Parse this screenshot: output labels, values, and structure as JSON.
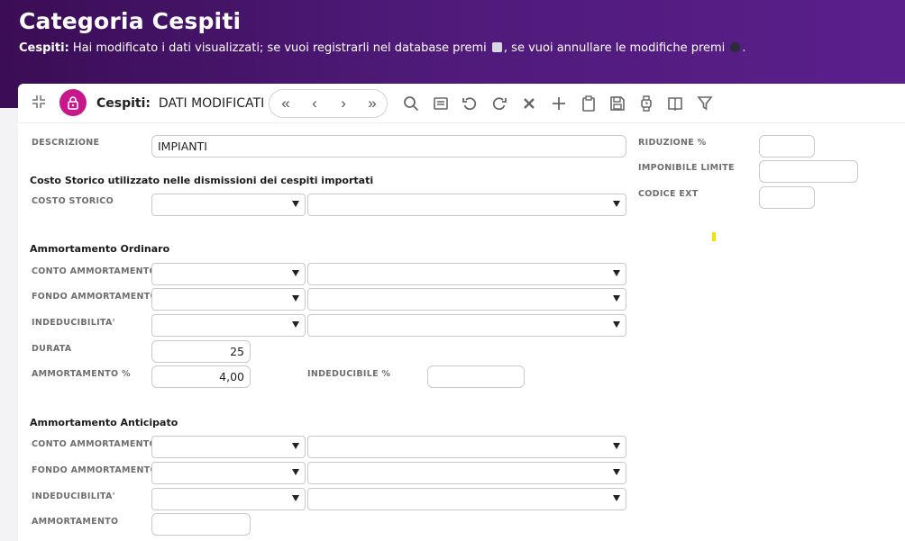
{
  "header": {
    "title": "Categoria Cespiti",
    "message_prefix": "Cespiti:",
    "message_part1": " Hai modificato i dati visualizzati; se vuoi registrarli nel database premi ",
    "message_part2": ", se vuoi annullare le modifiche premi ",
    "message_end": "."
  },
  "toolbar": {
    "title_prefix": "Cespiti:",
    "title_status": "DATI MODIFICATI",
    "nav": {
      "first": "«",
      "prev": "‹",
      "next": "›",
      "last": "»"
    }
  },
  "form": {
    "descrizione": {
      "label": "DESCRIZIONE",
      "value": "IMPIANTI"
    },
    "riduzione": {
      "label": "RIDUZIONE %",
      "value": ""
    },
    "imponibile_limite": {
      "label": "IMPONIBILE LIMITE",
      "value": ""
    },
    "codice_ext": {
      "label": "CODICE EXT",
      "value": ""
    },
    "costo_storico_section": "Costo Storico utilizzato nelle dismissioni dei cespiti importati",
    "costo_storico": {
      "label": "COSTO STORICO"
    },
    "ordinario_section": "Ammortamento Ordinaro",
    "ord_conto": {
      "label": "CONTO AMMORTAMENTO"
    },
    "ord_fondo": {
      "label": "FONDO AMMORTAMENTO"
    },
    "ord_indeducibilita": {
      "label": "INDEDUCIBILITA'"
    },
    "durata": {
      "label": "DURATA",
      "value": "25"
    },
    "ammortamento_perc": {
      "label": "AMMORTAMENTO %",
      "value": "4,00"
    },
    "indeducibile_perc": {
      "label": "INDEDUCIBILE %",
      "value": ""
    },
    "anticipato_section": "Ammortamento Anticipato",
    "ant_conto": {
      "label": "CONTO AMMORTAMENTO"
    },
    "ant_fondo": {
      "label": "FONDO AMMORTAMENTO"
    },
    "ant_indeducibilita": {
      "label": "INDEDUCIBILITA'"
    },
    "ant_ammortamento": {
      "label": "AMMORTAMENTO",
      "value": ""
    }
  },
  "colors": {
    "accent": "#c8178a",
    "header_start": "#3a0d55",
    "header_end": "#5b1f8c"
  }
}
